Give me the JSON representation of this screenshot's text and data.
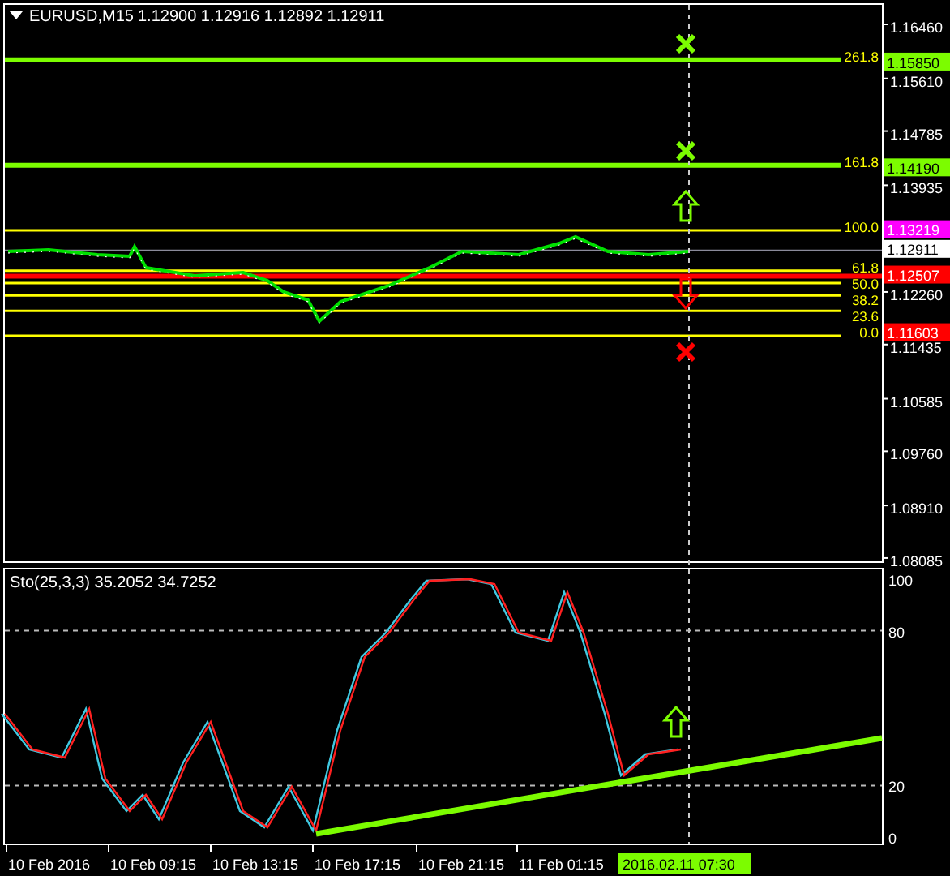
{
  "header": {
    "symbol": "EURUSD,M15",
    "ohlc": "1.12900 1.12916 1.12892 1.12911"
  },
  "price_axis": {
    "ticks": [
      "1.16460",
      "1.15610",
      "1.14785",
      "1.13935",
      "1.12260",
      "1.11435",
      "1.10585",
      "1.09760",
      "1.08910",
      "1.08085"
    ]
  },
  "price_labels": [
    {
      "text": "1.15850",
      "color": "#7cfc00"
    },
    {
      "text": "1.14190",
      "color": "#7cfc00"
    },
    {
      "text": "1.13219",
      "color": "#ff00ff"
    },
    {
      "text": "1.12911",
      "color": "#ffffff"
    },
    {
      "text": "1.12507",
      "color": "#ff0000"
    },
    {
      "text": "1.11603",
      "color": "#ff0000"
    }
  ],
  "fibonacci": {
    "levels": [
      {
        "label": "261.8"
      },
      {
        "label": "161.8"
      },
      {
        "label": "100.0"
      },
      {
        "label": "61.8"
      },
      {
        "label": "50.0"
      },
      {
        "label": "38.2"
      },
      {
        "label": "23.6"
      },
      {
        "label": "0.0"
      }
    ]
  },
  "markers": [
    {
      "kind": "cross",
      "color": "#7cfc00"
    },
    {
      "kind": "cross",
      "color": "#7cfc00"
    },
    {
      "kind": "up-arrow",
      "color": "#7cfc00"
    },
    {
      "kind": "down-arrow",
      "color": "#ff0000"
    },
    {
      "kind": "cross",
      "color": "#ff0000"
    },
    {
      "kind": "up-arrow",
      "color": "#7cfc00"
    }
  ],
  "stochastic": {
    "label": "Sto(25,3,3) 35.2052 34.7252",
    "ticks": [
      "100",
      "80",
      "20",
      "0"
    ]
  },
  "time_axis": {
    "labels": [
      "10 Feb 2016",
      "10 Feb 09:15",
      "10 Feb 13:15",
      "10 Feb 17:15",
      "10 Feb 21:15",
      "11 Feb 01:15"
    ],
    "cursor_label": "2016.02.11 07:30"
  }
}
